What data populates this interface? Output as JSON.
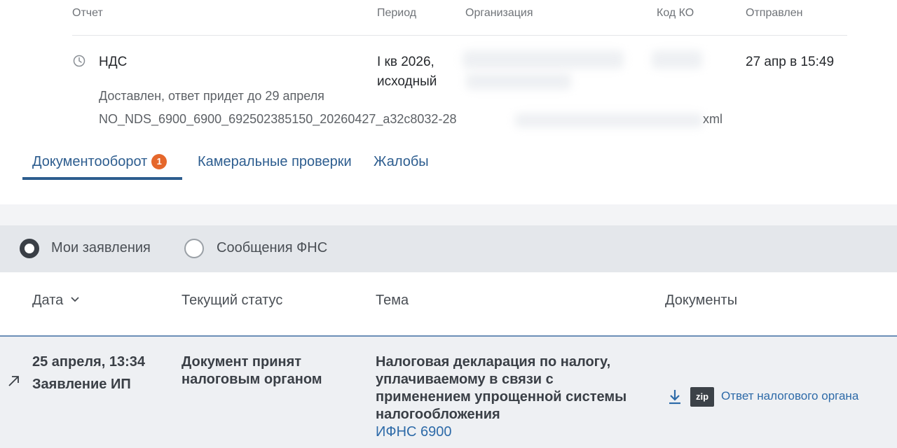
{
  "header": {
    "col_report": "Отчет",
    "col_period": "Период",
    "col_org": "Организация",
    "col_code": "Код КО",
    "col_sent": "Отправлен"
  },
  "report": {
    "name": "НДС",
    "period_line1": "I кв 2026,",
    "period_line2": "исходный",
    "sent": "27 апр в 15:49",
    "status": "Доставлен, ответ придет до 29 апреля",
    "filename": "NO_NDS_6900_6900_692502385150_20260427_a32c8032-28",
    "filename_ext": "xml"
  },
  "tabs": [
    {
      "label": "Документооборот",
      "badge": "1"
    },
    {
      "label": "Камеральные проверки"
    },
    {
      "label": "Жалобы"
    }
  ],
  "filters": {
    "option1": "Мои заявления",
    "option2": "Сообщения ФНС",
    "selected": "Мои заявления"
  },
  "table": {
    "headers": {
      "date": "Дата",
      "status": "Текущий статус",
      "topic": "Тема",
      "docs": "Документы"
    },
    "rows": [
      {
        "date": "25 апреля, 13:34",
        "type": "Заявление ИП",
        "status_line1": "Документ принят",
        "status_line2": "налоговым органом",
        "topic_line1": "Налоговая декларация по налогу,",
        "topic_line2": "уплачиваемому в связи с",
        "topic_line3": "применением упрощенной системы",
        "topic_line4": "налогообложения",
        "inspection": "ИФНС 6900",
        "doc_format": "zip",
        "doc_link": "Ответ налогового органа"
      }
    ]
  },
  "colors": {
    "accent": "#2d5d8f",
    "badge": "#e5672b",
    "link": "#2d6aa8"
  },
  "icons": [
    "clock-icon",
    "chevron-down-icon",
    "arrow-up-right-icon",
    "download-icon"
  ]
}
